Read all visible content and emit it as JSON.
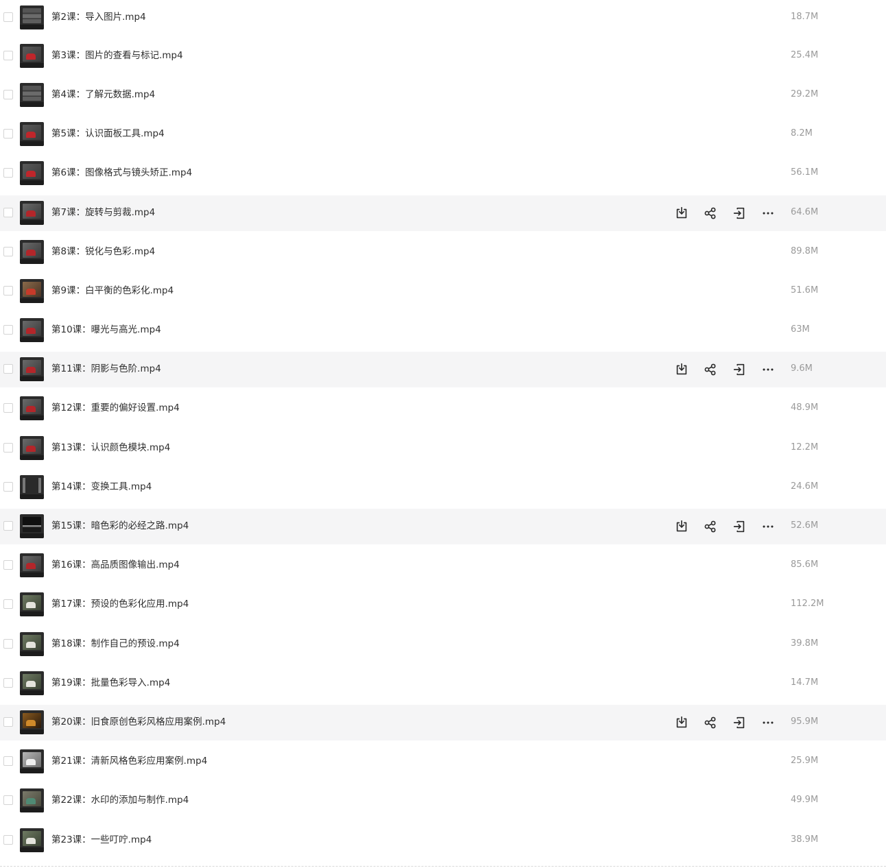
{
  "files": [
    {
      "name": "第2课：导入图片.mp4",
      "size": "18.7M",
      "hover": false,
      "thumb": "grid"
    },
    {
      "name": "第3课：图片的查看与标记.mp4",
      "size": "25.4M",
      "hover": false,
      "thumb": "red"
    },
    {
      "name": "第4课：了解元数据.mp4",
      "size": "29.2M",
      "hover": false,
      "thumb": "grid"
    },
    {
      "name": "第5课：认识面板工具.mp4",
      "size": "8.2M",
      "hover": false,
      "thumb": "red"
    },
    {
      "name": "第6课：图像格式与镜头矫正.mp4",
      "size": "56.1M",
      "hover": false,
      "thumb": "red"
    },
    {
      "name": "第7课：旋转与剪裁.mp4",
      "size": "64.6M",
      "hover": true,
      "thumb": "still"
    },
    {
      "name": "第8课：锐化与色彩.mp4",
      "size": "89.8M",
      "hover": false,
      "thumb": "still"
    },
    {
      "name": "第9课：白平衡的色彩化.mp4",
      "size": "51.6M",
      "hover": false,
      "thumb": "warm"
    },
    {
      "name": "第10课：曝光与高光.mp4",
      "size": "63M",
      "hover": false,
      "thumb": "still"
    },
    {
      "name": "第11课：阴影与色阶.mp4",
      "size": "9.6M",
      "hover": true,
      "thumb": "still"
    },
    {
      "name": "第12课：重要的偏好设置.mp4",
      "size": "48.9M",
      "hover": false,
      "thumb": "still"
    },
    {
      "name": "第13课：认识颜色模块.mp4",
      "size": "12.2M",
      "hover": false,
      "thumb": "still"
    },
    {
      "name": "第14课：变换工具.mp4",
      "size": "24.6M",
      "hover": false,
      "thumb": "window"
    },
    {
      "name": "第15课：暗色彩的必经之路.mp4",
      "size": "52.6M",
      "hover": true,
      "thumb": "dark"
    },
    {
      "name": "第16课：高品质图像输出.mp4",
      "size": "85.6M",
      "hover": false,
      "thumb": "still"
    },
    {
      "name": "第17课：预设的色彩化应用.mp4",
      "size": "112.2M",
      "hover": false,
      "thumb": "green"
    },
    {
      "name": "第18课：制作自己的预设.mp4",
      "size": "39.8M",
      "hover": false,
      "thumb": "green"
    },
    {
      "name": "第19课：批量色彩导入.mp4",
      "size": "14.7M",
      "hover": false,
      "thumb": "green"
    },
    {
      "name": "第20课：旧食原创色彩风格应用案例.mp4",
      "size": "95.9M",
      "hover": true,
      "thumb": "amber"
    },
    {
      "name": "第21课：清新风格色彩应用案例.mp4",
      "size": "25.9M",
      "hover": false,
      "thumb": "grey"
    },
    {
      "name": "第22课：水印的添加与制作.mp4",
      "size": "49.9M",
      "hover": false,
      "thumb": "cup"
    },
    {
      "name": "第23课：一些叮咛.mp4",
      "size": "38.9M",
      "hover": false,
      "thumb": "green"
    }
  ],
  "row_actions": [
    {
      "icon": "download-icon"
    },
    {
      "icon": "share-icon"
    },
    {
      "icon": "move-to-icon"
    },
    {
      "icon": "more-icon"
    }
  ],
  "colors": {
    "hover_row_bg": "#f5f5f6",
    "file_size_text": "#9a9a9a",
    "icon": "#2b2b2b"
  }
}
